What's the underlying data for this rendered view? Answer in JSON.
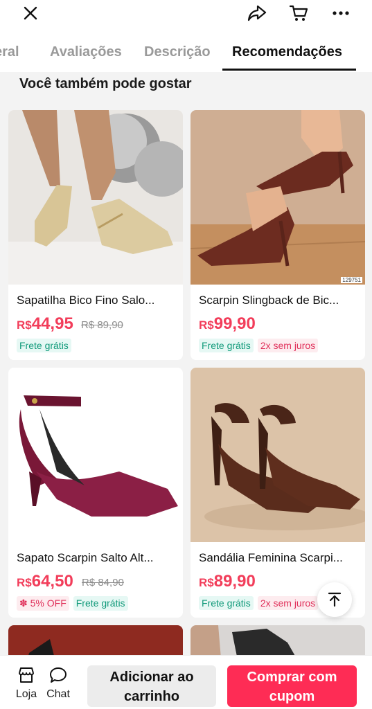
{
  "topbar": {
    "icons": [
      "close-icon",
      "share-icon",
      "cart-icon",
      "more-icon"
    ]
  },
  "tabs": [
    {
      "label": "Geral",
      "visible_label": "eral"
    },
    {
      "label": "Avaliações"
    },
    {
      "label": "Descrição"
    },
    {
      "label": "Recomendações",
      "active": true
    }
  ],
  "section_title": "Você também pode gostar",
  "products": [
    {
      "name": "Sapatilha Bico Fino Salo...",
      "currency": "R$",
      "price": "44,95",
      "old_price": "R$ 89,90",
      "badges": {
        "free": "Frete grátis"
      }
    },
    {
      "name": "Scarpin Slingback de Bic...",
      "currency": "R$",
      "price": "99,90",
      "image_code": "129751",
      "badges": {
        "free": "Frete grátis",
        "juros": "2x sem juros"
      }
    },
    {
      "name": "Sapato Scarpin Salto Alt...",
      "currency": "R$",
      "price": "64,50",
      "old_price": "R$ 84,90",
      "badges": {
        "off": "5% OFF",
        "free": "Frete grátis"
      }
    },
    {
      "name": "Sandália Feminina Scarpi...",
      "currency": "R$",
      "price": "89,90",
      "badges": {
        "free": "Frete grátis",
        "juros": "2x sem juros"
      }
    }
  ],
  "bottombar": {
    "loja_label": "Loja",
    "chat_label": "Chat",
    "add_line1": "Adicionar ao",
    "add_line2": "carrinho",
    "buy_line1": "Comprar com",
    "buy_line2": "cupom"
  },
  "colors": {
    "accent": "#fe2c55",
    "price": "#f23d5a",
    "free_shipping_text": "#119a7a",
    "free_shipping_bg": "#e6f8f4"
  }
}
